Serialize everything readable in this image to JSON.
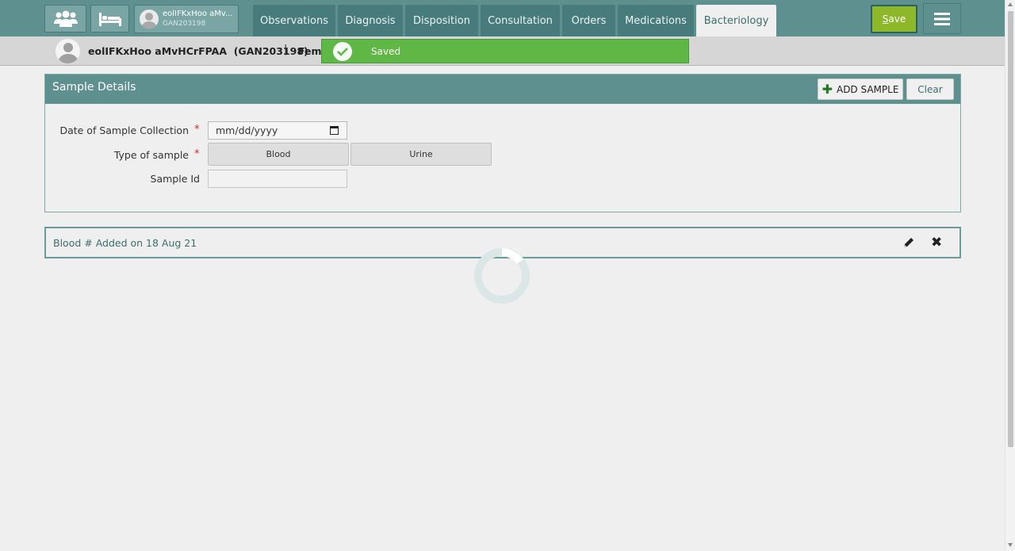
{
  "topbar": {
    "patients_icon": "patients-group-icon",
    "beds_icon": "bed-icon",
    "patient_chip": {
      "name": "eolIFKxHoo aMv...",
      "id": "GAN203198"
    },
    "tabs": [
      {
        "label": "Observations",
        "active": false
      },
      {
        "label": "Diagnosis",
        "active": false
      },
      {
        "label": "Disposition",
        "active": false
      },
      {
        "label": "Consultation",
        "active": false
      },
      {
        "label": "Orders",
        "active": false
      },
      {
        "label": "Medications",
        "active": false
      },
      {
        "label": "Bacteriology",
        "active": true
      }
    ],
    "save_label_key": "S",
    "save_label_rest": "ave",
    "menu_icon": "hamburger-menu-icon"
  },
  "patient_header": {
    "name": "eolIFKxHoo aMvHCrFPAA",
    "id": "(GAN203198)",
    "separator": "|",
    "gender": "Fema"
  },
  "toast": {
    "message": "Saved",
    "icon": "check-circle-icon",
    "color": "#5fb746"
  },
  "sample_details": {
    "title": "Sample Details",
    "add_button": "ADD SAMPLE",
    "clear_button": "Clear",
    "date_label": "Date of Sample Collection",
    "date_placeholder": "mm/dd/yyyy",
    "type_label": "Type of sample",
    "type_options": [
      "Blood",
      "Urine"
    ],
    "sample_id_label": "Sample Id",
    "sample_id_value": "",
    "required_marker": "*"
  },
  "samples": [
    {
      "text": "Blood # Added on 18 Aug 21"
    }
  ],
  "colors": {
    "header_teal": "#5e9090",
    "tab_teal": "#487c7c",
    "save_green": "#8cb82a",
    "required_red": "#d62a2a"
  }
}
